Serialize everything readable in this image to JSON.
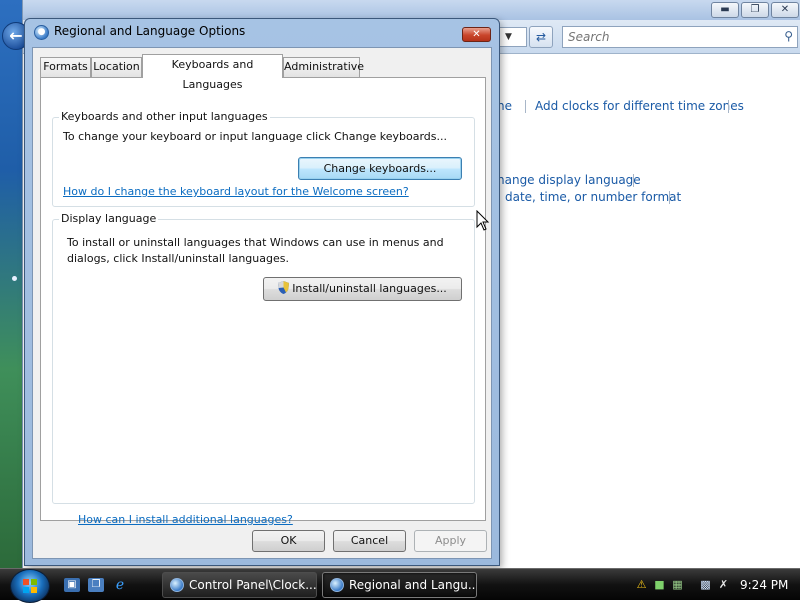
{
  "background_window": {
    "search": {
      "placeholder": "Search"
    },
    "links": {
      "partial_link_1": "ne",
      "add_clocks": "Add clocks for different time zones",
      "change_display_language": "hange display language",
      "change_format": "date, time, or number format"
    },
    "window_controls": {
      "minimize": "▬",
      "maximize": "❐",
      "close": "✕"
    }
  },
  "dialog": {
    "title": "Regional and Language Options",
    "tabs": [
      {
        "label": "Formats"
      },
      {
        "label": "Location"
      },
      {
        "label": "Keyboards and Languages",
        "active": true
      },
      {
        "label": "Administrative"
      }
    ],
    "keyboards_group": {
      "label": "Keyboards and other input languages",
      "description": "To change your keyboard or input language click Change keyboards...",
      "button": "Change keyboards...",
      "help_link": "How do I change the keyboard layout for the Welcome screen?"
    },
    "display_group": {
      "label": "Display language",
      "description_line1": "To install or uninstall languages that Windows can use in menus and",
      "description_line2": "dialogs, click Install/uninstall languages.",
      "button": "Install/uninstall languages..."
    },
    "footer_link": "How can I install additional languages?",
    "buttons": {
      "ok": "OK",
      "cancel": "Cancel",
      "apply": "Apply"
    }
  },
  "taskbar": {
    "tasks": [
      {
        "label": "Control Panel\\Clock...",
        "active": false
      },
      {
        "label": "Regional and Langu...",
        "active": true
      }
    ],
    "clock": "9:24 PM"
  }
}
